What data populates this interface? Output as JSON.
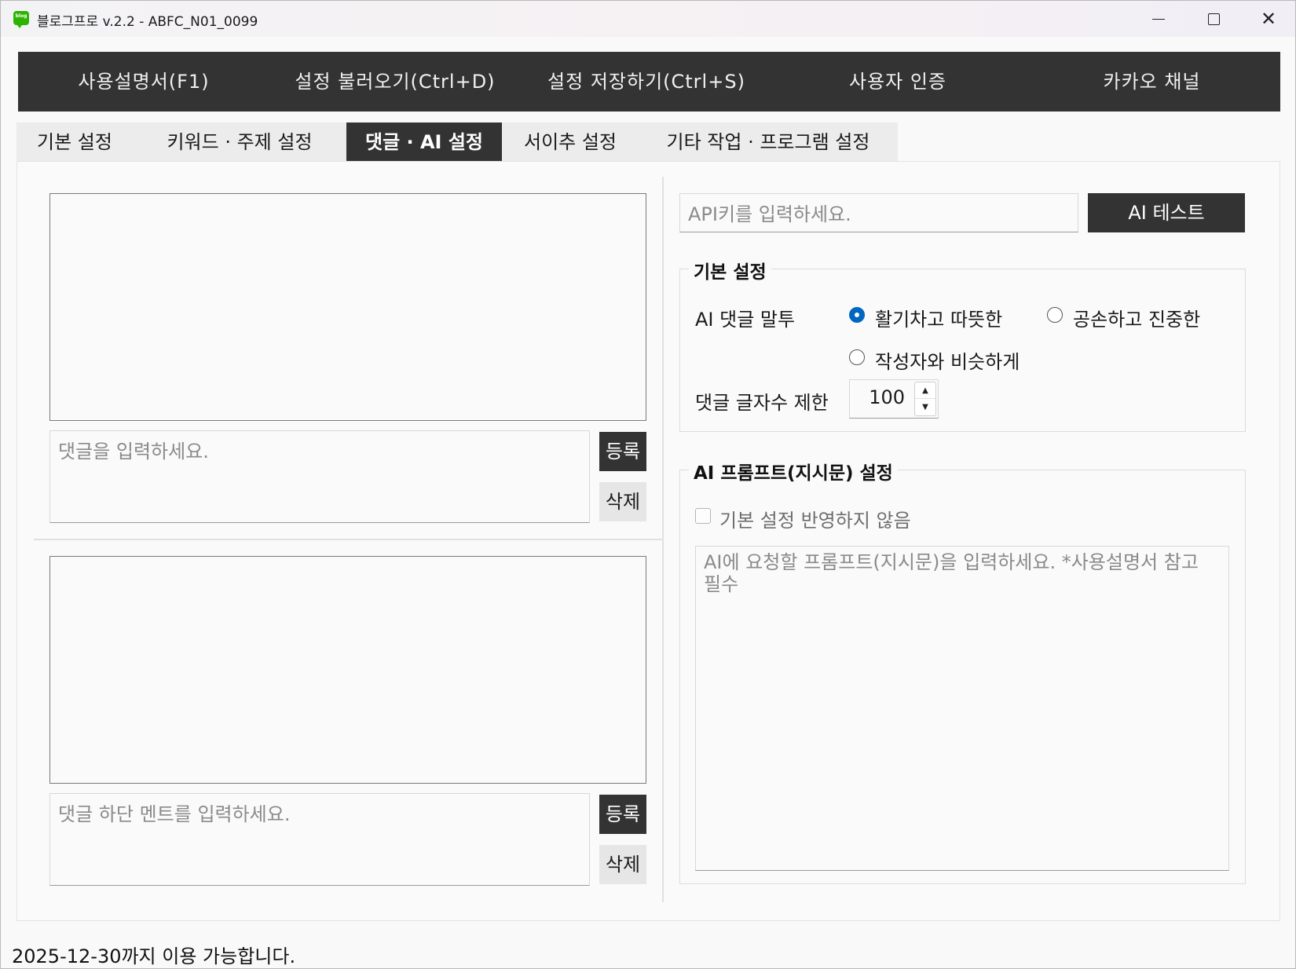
{
  "window": {
    "title": "블로그프로 v.2.2 - ABFC_N01_0099",
    "logo_text": "blog"
  },
  "menu": {
    "items": [
      {
        "label": "사용설명서(F1)"
      },
      {
        "label": "설정 불러오기(Ctrl+D)"
      },
      {
        "label": "설정 저장하기(Ctrl+S)"
      },
      {
        "label": "사용자 인증"
      },
      {
        "label": "카카오 채널"
      }
    ]
  },
  "tabs": [
    {
      "label": "기본 설정",
      "active": false
    },
    {
      "label": "키워드 · 주제 설정",
      "active": false
    },
    {
      "label": "댓글 · AI 설정",
      "active": true
    },
    {
      "label": "서이추 설정",
      "active": false
    },
    {
      "label": "기타 작업 · 프로그램 설정",
      "active": false
    }
  ],
  "comments": {
    "comment_placeholder": "댓글을 입력하세요.",
    "footer_placeholder": "댓글 하단 멘트를 입력하세요.",
    "register_label": "등록",
    "delete_label": "삭제"
  },
  "ai": {
    "api_key_placeholder": "API키를 입력하세요.",
    "test_button": "AI 테스트",
    "basic_group_title": "기본 설정",
    "tone_label": "AI 댓글 말투",
    "tone_options": [
      {
        "label": "활기차고 따뜻한",
        "checked": true
      },
      {
        "label": "공손하고 진중한",
        "checked": false
      },
      {
        "label": "작성자와 비슷하게",
        "checked": false
      }
    ],
    "char_limit_label": "댓글 글자수 제한",
    "char_limit_value": "100",
    "prompt_group_title": "AI 프롬프트(지시문) 설정",
    "ignore_basic_label": "기본 설정 반영하지 않음",
    "ignore_basic_checked": false,
    "prompt_placeholder": "AI에 요청할 프롬프트(지시문)을 입력하세요. *사용설명서 참고 필수"
  },
  "status": {
    "text": "2025-12-30까지 이용 가능합니다."
  },
  "colors": {
    "dark": "#333333",
    "radio_accent": "#0067c0",
    "logo_green": "#2db400"
  }
}
